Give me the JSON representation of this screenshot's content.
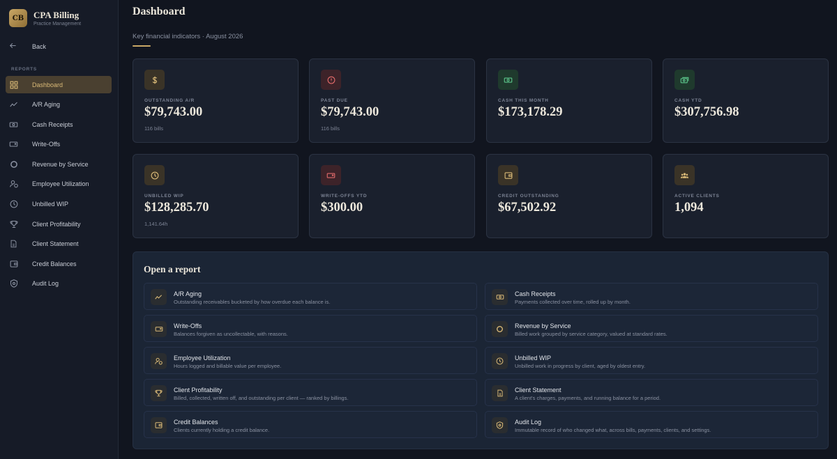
{
  "brand": {
    "logo": "CB",
    "title": "CPA Billing",
    "subtitle": "Practice Management"
  },
  "back_label": "Back",
  "section_label": "REPORTS",
  "nav": [
    {
      "label": "Dashboard",
      "icon": "dashboard-icon",
      "active": true
    },
    {
      "label": "A/R Aging",
      "icon": "trend-icon"
    },
    {
      "label": "Cash Receipts",
      "icon": "cash-icon"
    },
    {
      "label": "Write-Offs",
      "icon": "writeoff-icon"
    },
    {
      "label": "Revenue by Service",
      "icon": "donut-icon"
    },
    {
      "label": "Employee Utilization",
      "icon": "employee-icon"
    },
    {
      "label": "Unbilled WIP",
      "icon": "clock-icon"
    },
    {
      "label": "Client Profitability",
      "icon": "trophy-icon"
    },
    {
      "label": "Client Statement",
      "icon": "document-icon"
    },
    {
      "label": "Credit Balances",
      "icon": "wallet-icon"
    },
    {
      "label": "Audit Log",
      "icon": "shield-icon"
    }
  ],
  "header": {
    "title": "Dashboard",
    "subtitle": "Key financial indicators · August 2026"
  },
  "kpis": [
    {
      "label": "OUTSTANDING A/R",
      "value": "$79,743.00",
      "note": "116 bills",
      "icon": "dollar-icon",
      "tone": "gold"
    },
    {
      "label": "PAST DUE",
      "value": "$79,743.00",
      "note": "116 bills",
      "icon": "alert-icon",
      "tone": "red"
    },
    {
      "label": "CASH THIS MONTH",
      "value": "$173,178.29",
      "note": "",
      "icon": "cash-icon",
      "tone": "green"
    },
    {
      "label": "CASH YTD",
      "value": "$307,756.98",
      "note": "",
      "icon": "cash-stack-icon",
      "tone": "green"
    },
    {
      "label": "UNBILLED WIP",
      "value": "$128,285.70",
      "note": "1,141.64h",
      "icon": "clock-icon",
      "tone": "gold"
    },
    {
      "label": "WRITE-OFFS YTD",
      "value": "$300.00",
      "note": "",
      "icon": "writeoff-icon",
      "tone": "red"
    },
    {
      "label": "CREDIT OUTSTANDING",
      "value": "$67,502.92",
      "note": "",
      "icon": "wallet-icon",
      "tone": "gold"
    },
    {
      "label": "ACTIVE CLIENTS",
      "value": "1,094",
      "note": "",
      "icon": "users-icon",
      "tone": "gold"
    }
  ],
  "reports_panel": {
    "title": "Open a report",
    "items": [
      {
        "title": "A/R Aging",
        "desc": "Outstanding receivables bucketed by how overdue each balance is.",
        "icon": "trend-icon"
      },
      {
        "title": "Cash Receipts",
        "desc": "Payments collected over time, rolled up by month.",
        "icon": "cash-icon"
      },
      {
        "title": "Write-Offs",
        "desc": "Balances forgiven as uncollectable, with reasons.",
        "icon": "writeoff-icon"
      },
      {
        "title": "Revenue by Service",
        "desc": "Billed work grouped by service category, valued at standard rates.",
        "icon": "donut-icon"
      },
      {
        "title": "Employee Utilization",
        "desc": "Hours logged and billable value per employee.",
        "icon": "employee-icon"
      },
      {
        "title": "Unbilled WIP",
        "desc": "Unbilled work in progress by client, aged by oldest entry.",
        "icon": "clock-icon"
      },
      {
        "title": "Client Profitability",
        "desc": "Billed, collected, written off, and outstanding per client — ranked by billings.",
        "icon": "trophy-icon"
      },
      {
        "title": "Client Statement",
        "desc": "A client's charges, payments, and running balance for a period.",
        "icon": "document-icon"
      },
      {
        "title": "Credit Balances",
        "desc": "Clients currently holding a credit balance.",
        "icon": "wallet-icon"
      },
      {
        "title": "Audit Log",
        "desc": "Immutable record of who changed what, across bills, payments, clients, and settings.",
        "icon": "shield-icon"
      }
    ]
  }
}
